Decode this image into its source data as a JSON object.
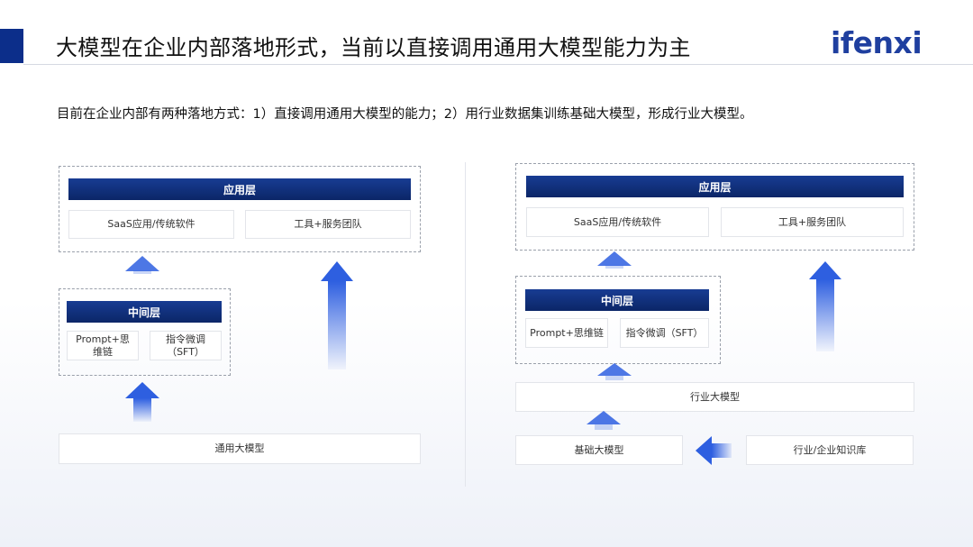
{
  "header": {
    "title": "大模型在企业内部落地形式，当前以直接调用通用大模型能力为主",
    "logo": "ifenxi"
  },
  "subtitle": "目前在企业内部有两种落地方式：1）直接调用通用大模型的能力；2）用行业数据集训练基础大模型，形成行业大模型。",
  "left_diagram": {
    "app_layer": {
      "title": "应用层",
      "items": [
        "SaaS应用/传统软件",
        "工具+服务团队"
      ]
    },
    "middle_layer": {
      "title": "中间层",
      "items": [
        "Prompt+思维链",
        "指令微调（SFT）"
      ]
    },
    "base": "通用大模型"
  },
  "right_diagram": {
    "app_layer": {
      "title": "应用层",
      "items": [
        "SaaS应用/传统软件",
        "工具+服务团队"
      ]
    },
    "middle_layer": {
      "title": "中间层",
      "items": [
        "Prompt+思维链",
        "指令微调（SFT）"
      ]
    },
    "industry_model": "行业大模型",
    "base": "基础大模型",
    "knowledge_base": "行业/企业知识库"
  },
  "colors": {
    "accent": "#0c2e8a",
    "arrow": "#2e5fe0"
  }
}
